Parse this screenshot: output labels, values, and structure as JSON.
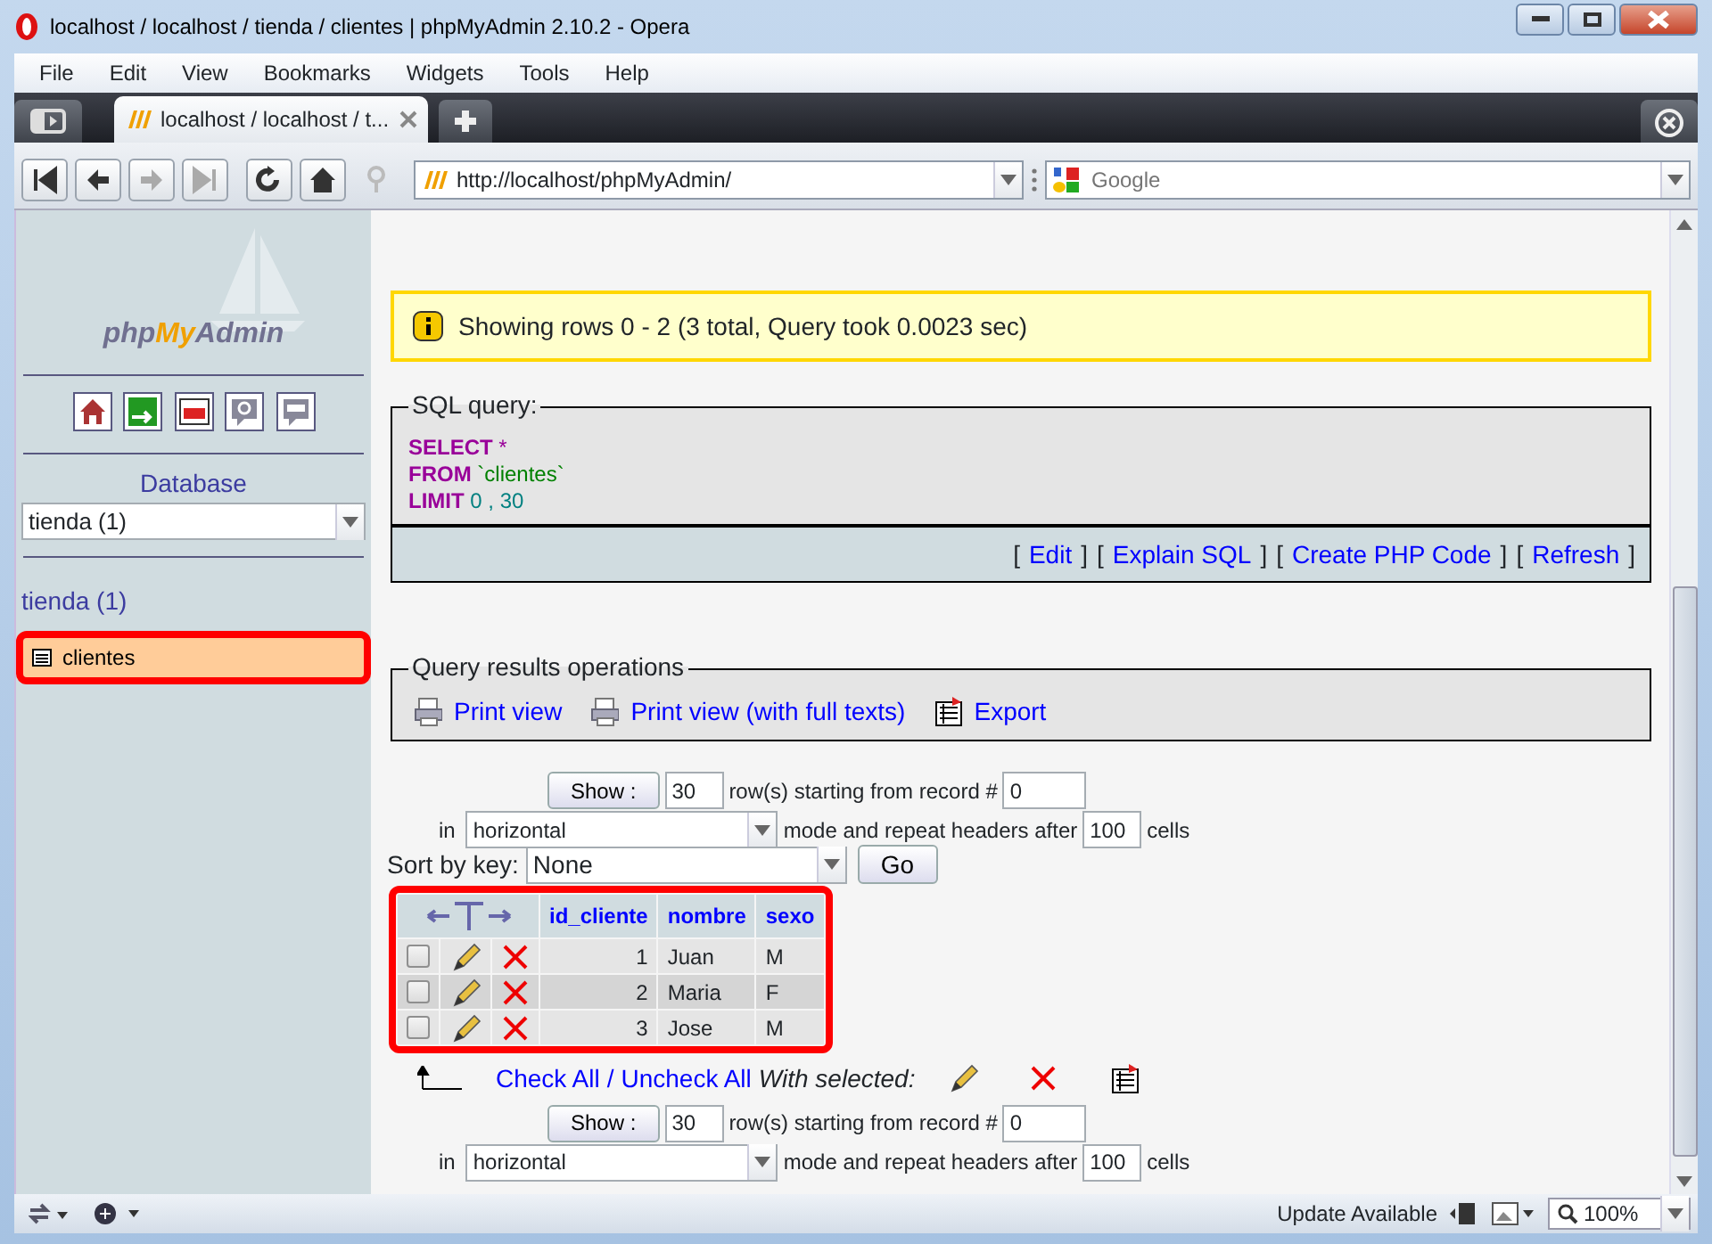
{
  "window": {
    "title": "localhost / localhost / tienda / clientes | phpMyAdmin 2.10.2 - Opera"
  },
  "menu": [
    "File",
    "Edit",
    "View",
    "Bookmarks",
    "Widgets",
    "Tools",
    "Help"
  ],
  "tabs": [
    {
      "label": "localhost / localhost / t...",
      "selected": true
    }
  ],
  "address": {
    "value": "http://localhost/phpMyAdmin/"
  },
  "search": {
    "placeholder": "Google"
  },
  "sidebar": {
    "logo": "phpMyAdmin",
    "database_label": "Database",
    "database_select": "tienda (1)",
    "db_title": "tienda (1)",
    "tables": [
      {
        "name": "clientes",
        "selected": true,
        "highlighted": true
      }
    ]
  },
  "notice": "Showing rows 0 - 2 (3 total, Query took 0.0023 sec)",
  "sql": {
    "legend": "SQL query:",
    "lines": [
      [
        {
          "kind": "keyword",
          "text": "SELECT"
        },
        {
          "kind": "punct",
          "text": " *"
        }
      ],
      [
        {
          "kind": "keyword",
          "text": "FROM"
        },
        {
          "kind": "string",
          "text": " `clientes`"
        }
      ],
      [
        {
          "kind": "keyword",
          "text": "LIMIT"
        },
        {
          "kind": "number",
          "text": " 0 , 30"
        }
      ]
    ],
    "brackets": [
      "[",
      "]"
    ],
    "links": [
      "Edit",
      "Explain SQL",
      "Create PHP Code",
      "Refresh"
    ]
  },
  "operations": {
    "legend": "Query results operations",
    "items": [
      {
        "kind": "print",
        "label": "Print view"
      },
      {
        "kind": "print",
        "label": "Print view (with full texts)"
      },
      {
        "kind": "export",
        "label": "Export"
      }
    ]
  },
  "nav_forms": [
    {
      "show": "Show :",
      "rows": "30",
      "rows_text": "row(s) starting from record #",
      "start": "0",
      "in": "in",
      "mode": "horizontal",
      "mode_text": "mode and repeat headers after",
      "headers": "100",
      "cells": "cells"
    },
    {
      "show": "Show :",
      "rows": "30",
      "rows_text": "row(s) starting from record #",
      "start": "0",
      "in": "in",
      "mode": "horizontal",
      "mode_text": "mode and repeat headers after",
      "headers": "100",
      "cells": "cells"
    }
  ],
  "sort": {
    "label": "Sort by key:",
    "value": "None",
    "go": "Go"
  },
  "table": {
    "highlighted": true,
    "columns": [
      "id_cliente",
      "nombre",
      "sexo"
    ],
    "rows": [
      {
        "checked": false,
        "cells": [
          "1",
          "Juan",
          "M"
        ]
      },
      {
        "checked": false,
        "cells": [
          "2",
          "Maria",
          "F"
        ]
      },
      {
        "checked": false,
        "cells": [
          "3",
          "Jose",
          "M"
        ]
      }
    ]
  },
  "bulk": {
    "check_all": "Check All",
    "separator": "/",
    "uncheck_all": "Uncheck All",
    "with_selected": "With selected:"
  },
  "status_bar": {
    "update": "Update Available",
    "zoom": "100%"
  }
}
